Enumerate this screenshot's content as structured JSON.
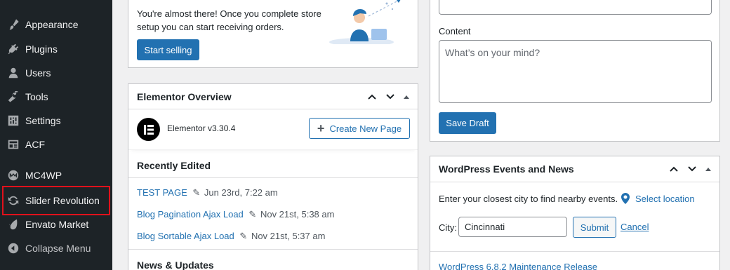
{
  "sidebar": {
    "items": [
      {
        "label": "Appearance",
        "icon": "paintbrush-icon"
      },
      {
        "label": "Plugins",
        "icon": "plug-icon"
      },
      {
        "label": "Users",
        "icon": "users-icon"
      },
      {
        "label": "Tools",
        "icon": "wrench-icon"
      },
      {
        "label": "Settings",
        "icon": "settings-sliders-icon"
      },
      {
        "label": "ACF",
        "icon": "acf-icon"
      },
      {
        "label": "MC4WP",
        "icon": "mc4wp-icon"
      },
      {
        "label": "Slider Revolution",
        "icon": "revolution-icon"
      },
      {
        "label": "Envato Market",
        "icon": "envato-icon"
      },
      {
        "label": "Collapse Menu",
        "icon": "collapse-arrow-icon"
      }
    ],
    "highlight_color": "#e1111b"
  },
  "store_setup": {
    "text_line1": "You're almost there! Once you complete store",
    "text_line2": "setup you can start receiving orders.",
    "button": "Start selling"
  },
  "elementor": {
    "title": "Elementor Overview",
    "version": "Elementor v3.30.4",
    "create_button": "Create New Page",
    "recently_edited_heading": "Recently Edited",
    "recent": [
      {
        "title": "TEST PAGE",
        "date": "Jun 23rd, 7:22 am"
      },
      {
        "title": "Blog Pagination Ajax Load",
        "date": "Nov 21st, 5:38 am"
      },
      {
        "title": "Blog Sortable Ajax Load",
        "date": "Nov 21st, 5:37 am"
      }
    ],
    "news_heading": "News & Updates"
  },
  "quick_draft": {
    "content_label": "Content",
    "content_placeholder": "What’s on your mind?",
    "save_button": "Save Draft"
  },
  "events": {
    "title": "WordPress Events and News",
    "prompt": "Enter your closest city to find nearby events.",
    "select_location": "Select location",
    "city_label": "City:",
    "city_value": "Cincinnati",
    "submit": "Submit",
    "cancel": "Cancel",
    "news_item": "WordPress 6.8.2 Maintenance Release"
  },
  "colors": {
    "accent": "#2271b1",
    "sidebar_bg": "#1d2327",
    "page_bg": "#f0f0f1"
  }
}
